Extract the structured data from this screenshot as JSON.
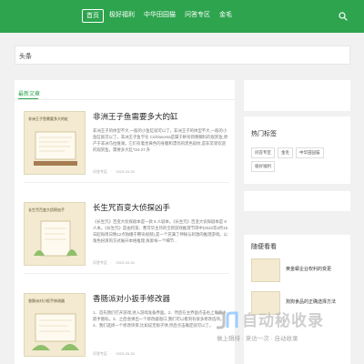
{
  "nav": {
    "items": [
      {
        "label": "首页",
        "active": true
      },
      {
        "label": "极好福利"
      },
      {
        "label": "中华田园猫"
      },
      {
        "label": "问答专区"
      },
      {
        "label": "金毛"
      }
    ]
  },
  "headline": {
    "label": "头条"
  },
  "main": {
    "tab_label": "最新文章",
    "articles": [
      {
        "thumb_title": "非洲王子鱼需要多大的缸",
        "title": "非洲王子鱼需要多大的缸",
        "excerpt": "非洲王子的体型不大,一般的小鱼缸就可以了。非洲王子的体型不大,一般的小鱼缸就可以了。非洲王子鱼学名 Cichlasoma是属于鲈形目慈鲷科的观赏鱼,原产于非洲马拉维湖。它们有着金黄色的身躯和漂亮的黑色斑纹,是非常受欢迎的观赏鱼。需要多大缸?24-27 升",
        "author": "问答专区",
        "date": "2023-03-30"
      },
      {
        "thumb_title": "长生咒百变大侦探凶手",
        "title": "长生咒百变大侦探凶手",
        "excerpt": "《长生咒》百变大侦探剧本是一款 8 人剧本。《长生咒》百变大侦探剧本是 8 人本。《长生咒》是由何宽、曹可华主持的全新游戏推理节目中(2022年8月15日起每周日晚12点独播于腾讯视频),是一个充满了神秘与刺激的推理游戏。以角色扮演的方式展开本格推理,探索每一个细节...",
        "author": "问答专区",
        "date": "2023-03-30"
      },
      {
        "thumb_title": "香肠派对小扳手修改器",
        "title": "香肠派对小扳手修改器",
        "excerpt": "1、首先我们打开游戏,进入游戏准备界面。2、然后在主界面点击右上角的小扳手图标。3、之后会弹出一个修改器窗口,我们可以看到有很多修改选项。4、我们选择一个修改项目,比如说无限子弹,然后点击确定就可以了。",
        "author": "问答专区",
        "date": "2023-03-30"
      }
    ]
  },
  "sidebar": {
    "hot_tags": {
      "heading": "热门标签",
      "tags": [
        "问答专区",
        "金毛",
        "中华田园猫",
        "极好福利"
      ]
    },
    "random": {
      "heading": "随便看看",
      "items": [
        {
          "title": "黄金蟒企业权利的变更"
        },
        {
          "title": "狗狗食品的正确选择方法"
        }
      ]
    }
  },
  "watermark": {
    "main": "自动秘收录",
    "sub": "做上辑排 · 来访一次 · 自动收录"
  },
  "colors": {
    "accent": "#2ea44f"
  }
}
